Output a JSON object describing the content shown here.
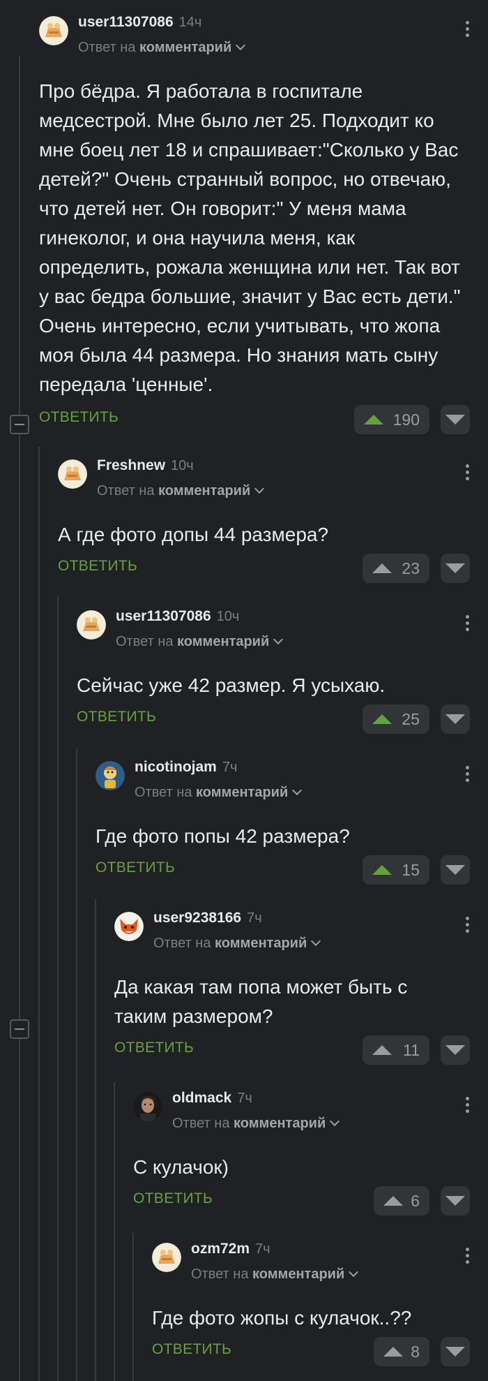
{
  "reply_label": "ОТВЕТИТЬ",
  "reply_to_prefix": "Ответ на",
  "reply_to_target": "комментарий",
  "colors": {
    "vote_up_active": "#67a13d",
    "vote_up_inactive": "#9a9ca1",
    "reply": "#67a13d"
  },
  "comments": [
    {
      "user": "user11307086",
      "time": "14ч",
      "avatar": "cat-in-bag-avatar",
      "text": "Про бёдра. Я работала в госпитале медсестрой. Мне было лет 25. Подходит ко мне боец лет 18 и спрашивает:\"Сколько у Вас детей?\" Очень странный вопрос, но отвечаю, что детей нет. Он говорит:\" У меня мама гинеколог, и она научила меня, как определить, рожала женщина или нет. Так вот у вас бедра большие, значит у Вас есть дети.\" Очень интересно, если учитывать, что жопа моя была 44 размера. Но знания мать сыну передала 'ценные'.",
      "votes": "190",
      "upvoted": true
    },
    {
      "user": "Freshnew",
      "time": "10ч",
      "avatar": "cat-in-bag-avatar",
      "text": "А где фото допы 44 размера?",
      "votes": "23",
      "upvoted": false
    },
    {
      "user": "user11307086",
      "time": "10ч",
      "avatar": "cat-in-bag-avatar",
      "text": "Сейчас уже 42 размер. Я усыхаю.",
      "votes": "25",
      "upvoted": true
    },
    {
      "user": "nicotinojam",
      "time": "7ч",
      "avatar": "vault-boy-avatar",
      "text": "Где фото попы 42 размера?",
      "votes": "15",
      "upvoted": true
    },
    {
      "user": "user9238166",
      "time": "7ч",
      "avatar": "fox-avatar",
      "text": "Да какая там попа может быть с таким размером?",
      "votes": "11",
      "upvoted": false
    },
    {
      "user": "oldmack",
      "time": "7ч",
      "avatar": "man-photo-avatar",
      "text": "С кулачок)",
      "votes": "6",
      "upvoted": false
    },
    {
      "user": "ozm72m",
      "time": "7ч",
      "avatar": "cat-in-bag-avatar",
      "text": "Где фото жопы с кулачок..??",
      "votes": "8",
      "upvoted": false
    }
  ]
}
